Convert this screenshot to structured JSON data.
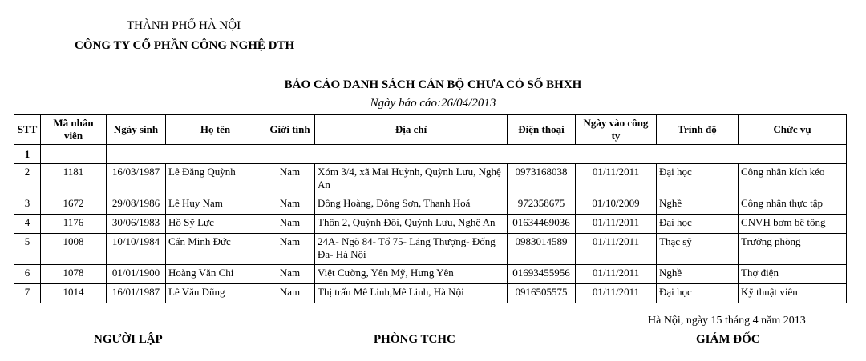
{
  "header": {
    "city": "THÀNH PHỐ HÀ NỘI",
    "company": "CÔNG TY CỔ PHẦN CÔNG NGHỆ DTH"
  },
  "report": {
    "title": "BÁO CÁO DANH SÁCH CÁN BỘ CHƯA CÓ SỔ BHXH",
    "date_line": "Ngày báo cáo:26/04/2013"
  },
  "table": {
    "columns": [
      "STT",
      "Mã nhân viên",
      "Ngày sinh",
      "Họ tên",
      "Giới tính",
      "Địa chỉ",
      "Điện thoại",
      "Ngày vào công ty",
      "Trình độ",
      "Chức vụ"
    ],
    "group_label": "1",
    "rows": [
      {
        "stt": "2",
        "ma": "1181",
        "ngay_sinh": "16/03/1987",
        "ho_ten": "Lê Đăng Quỳnh",
        "gioi_tinh": "Nam",
        "dia_chi": "Xóm 3/4, xã Mai Huỳnh, Quỳnh Lưu, Nghệ An",
        "dien_thoai": "0973168038",
        "ngay_vao": "01/11/2011",
        "trinh_do": "Đại học",
        "chuc_vu": "Công nhân kích kéo"
      },
      {
        "stt": "3",
        "ma": "1672",
        "ngay_sinh": "29/08/1986",
        "ho_ten": "Lê Huy Nam",
        "gioi_tinh": "Nam",
        "dia_chi": "Đông Hoàng, Đông Sơn, Thanh Hoá",
        "dien_thoai": "972358675",
        "ngay_vao": "01/10/2009",
        "trinh_do": "Nghề",
        "chuc_vu": "Công nhân thực tập"
      },
      {
        "stt": "4",
        "ma": "1176",
        "ngay_sinh": "30/06/1983",
        "ho_ten": "Hồ Sỹ Lực",
        "gioi_tinh": "Nam",
        "dia_chi": "Thôn 2, Quỳnh Đôi, Quỳnh Lưu, Nghệ An",
        "dien_thoai": "01634469036",
        "ngay_vao": "01/11/2011",
        "trinh_do": "Đại học",
        "chuc_vu": "CNVH bơm bê tông"
      },
      {
        "stt": "5",
        "ma": "1008",
        "ngay_sinh": "10/10/1984",
        "ho_ten": "Cấn Minh Đức",
        "gioi_tinh": "Nam",
        "dia_chi": "24A- Ngõ 84- Tổ 75- Láng Thượng- Đống Đa- Hà Nội",
        "dien_thoai": "0983014589",
        "ngay_vao": "01/11/2011",
        "trinh_do": "Thạc sỹ",
        "chuc_vu": "Trưởng phòng"
      },
      {
        "stt": "6",
        "ma": "1078",
        "ngay_sinh": "01/01/1900",
        "ho_ten": "Hoàng Văn Chi",
        "gioi_tinh": "Nam",
        "dia_chi": "Việt Cường, Yên Mỹ, Hưng Yên",
        "dien_thoai": "01693455956",
        "ngay_vao": "01/11/2011",
        "trinh_do": "Nghề",
        "chuc_vu": "Thợ điện"
      },
      {
        "stt": "7",
        "ma": "1014",
        "ngay_sinh": "16/01/1987",
        "ho_ten": "Lê Văn Dũng",
        "gioi_tinh": "Nam",
        "dia_chi": "Thị trấn Mê Linh,Mê Linh, Hà Nội",
        "dien_thoai": "0916505575",
        "ngay_vao": "01/11/2011",
        "trinh_do": "Đại học",
        "chuc_vu": "Kỹ thuật viên"
      }
    ]
  },
  "footer": {
    "date_place": "Hà Nội, ngày 15 tháng 4 năm 2013",
    "signer_1": "NGƯỜI LẬP",
    "signer_2": "PHÒNG TCHC",
    "signer_3": "GIÁM ĐỐC"
  }
}
